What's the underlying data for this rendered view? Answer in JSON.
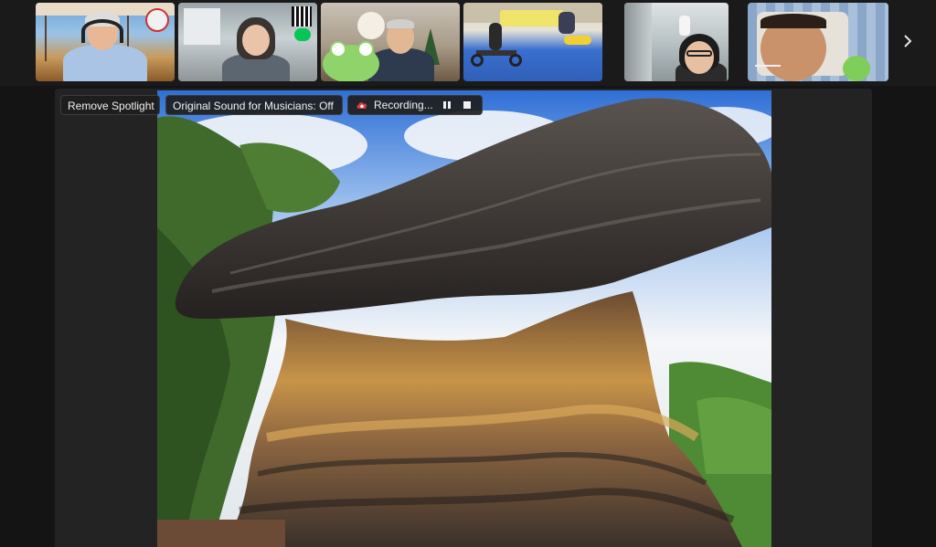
{
  "toolbar": {
    "remove_spotlight_label": "Remove Spotlight",
    "original_sound_label": "Original Sound for Musicians: Off",
    "recording_label": "Recording..."
  },
  "participants": [
    {
      "id": "p1",
      "scene": "office-window",
      "headphones": true
    },
    {
      "id": "p2",
      "scene": "home-office"
    },
    {
      "id": "p3",
      "scene": "living-room-with-frog-plush"
    },
    {
      "id": "p4",
      "scene": "play-area-with-bike"
    },
    {
      "id": "p5",
      "scene": "corridor-selfie"
    },
    {
      "id": "p6",
      "scene": "lying-on-pillow"
    }
  ],
  "icons": {
    "next_page": "chevron-right-icon",
    "recording": "cloud-record-icon",
    "pause": "pause-icon",
    "stop": "stop-icon",
    "qr": "qr-code-icon",
    "line_badge": "LINE"
  },
  "shared_content": {
    "subject": "rock-formation-photo"
  },
  "colors": {
    "background": "#141414",
    "stage": "#232323",
    "pill_bg": "#1e1e1e",
    "recording_red": "#e0383b",
    "line_green": "#06c755"
  }
}
